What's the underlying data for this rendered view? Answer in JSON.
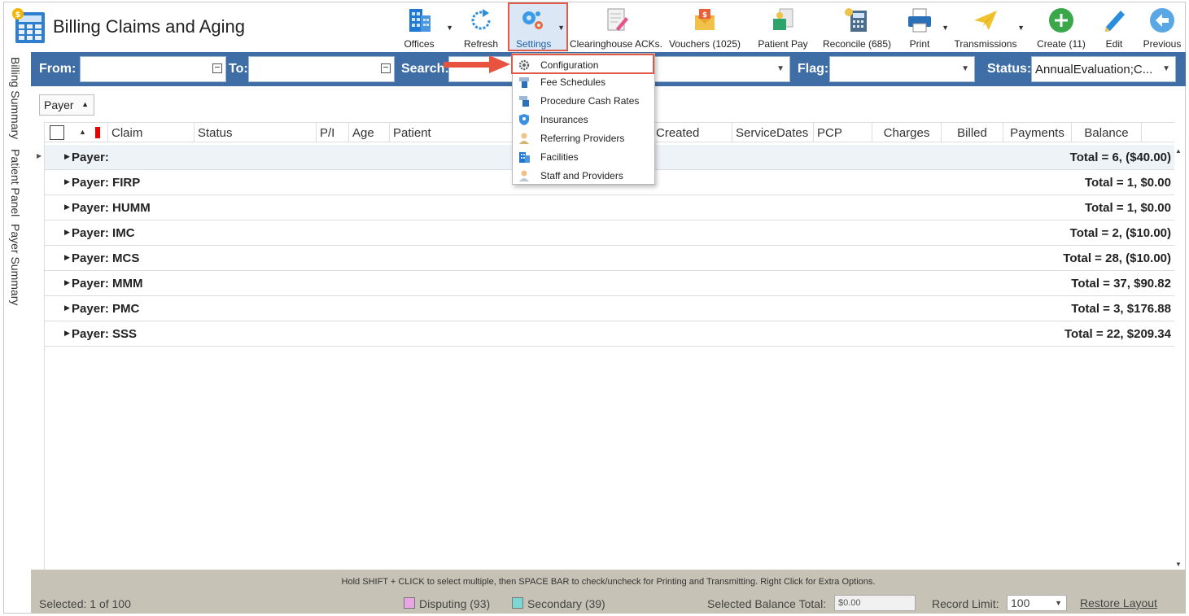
{
  "app": {
    "title": "Billing Claims and Aging"
  },
  "toolbar": {
    "offices": "Offices",
    "refresh": "Refresh",
    "settings": "Settings",
    "clearinghouse": "Clearinghouse ACKs.",
    "vouchers": "Vouchers (1025)",
    "patient_pay": "Patient Pay",
    "reconcile": "Reconcile (685)",
    "print": "Print",
    "transmissions": "Transmissions",
    "create": "Create (11)",
    "edit": "Edit",
    "previous": "Previous"
  },
  "filters": {
    "from_label": "From:",
    "to_label": "To:",
    "search_label": "Search:",
    "flag_label": "Flag:",
    "status_label": "Status:",
    "status_value": "AnnualEvaluation;C..."
  },
  "side_tabs": [
    "Billing Summary",
    "Patient Panel",
    "Payer Summary"
  ],
  "group_by": "Payer",
  "grid": {
    "columns": [
      "Claim",
      "Status",
      "P/I",
      "Age",
      "Patient",
      "Created",
      "ServiceDates",
      "PCP",
      "Charges",
      "Billed",
      "Payments",
      "Balance"
    ],
    "groups": [
      {
        "name": "Payer:",
        "total": "Total = 6,  ($40.00)"
      },
      {
        "name": "Payer: FIRP",
        "total": "Total = 1,  $0.00"
      },
      {
        "name": "Payer: HUMM",
        "total": "Total = 1,  $0.00"
      },
      {
        "name": "Payer: IMC",
        "total": "Total = 2,  ($10.00)"
      },
      {
        "name": "Payer: MCS",
        "total": "Total = 28,  ($10.00)"
      },
      {
        "name": "Payer: MMM",
        "total": "Total = 37,  $90.82"
      },
      {
        "name": "Payer: PMC",
        "total": "Total = 3,  $176.88"
      },
      {
        "name": "Payer: SSS",
        "total": "Total = 22,  $209.34"
      }
    ]
  },
  "settings_menu": {
    "items": [
      {
        "label": "Configuration",
        "icon": "gear-icon"
      },
      {
        "label": "Fee Schedules",
        "icon": "fee-schedule-icon"
      },
      {
        "label": "Procedure Cash Rates",
        "icon": "cash-rates-icon"
      },
      {
        "label": "Insurances",
        "icon": "shield-icon"
      },
      {
        "label": "Referring Providers",
        "icon": "provider-icon"
      },
      {
        "label": "Facilities",
        "icon": "building-icon"
      },
      {
        "label": "Staff and Providers",
        "icon": "staff-icon"
      }
    ]
  },
  "status": {
    "hint": "Hold SHIFT + CLICK to select multiple, then SPACE BAR to check/uncheck for Printing and Transmitting. Right Click for Extra Options.",
    "selected": "Selected: 1 of 100",
    "disputing": "Disputing (93)",
    "secondary": "Secondary (39)",
    "selected_balance_label": "Selected Balance Total:",
    "selected_balance_value": "$0.00",
    "record_limit_label": "Record Limit:",
    "record_limit_value": "100",
    "restore_layout": "Restore Layout"
  },
  "colors": {
    "filter_bar": "#3f6ea6",
    "disputing": "#e9a6e6",
    "secondary": "#7ad7d3",
    "highlight": "#e05a4a"
  }
}
